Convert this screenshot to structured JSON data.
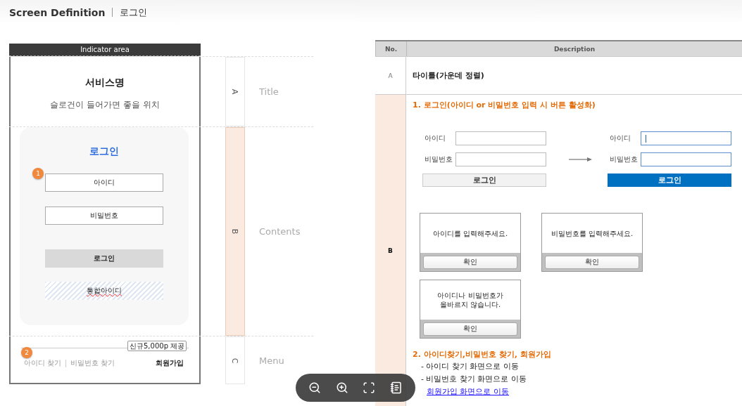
{
  "header": {
    "title": "Screen Definition",
    "subtitle": "로그인"
  },
  "phone": {
    "indicator": "Indicator area",
    "service_name": "서비스명",
    "slogan": "슬로건이 들어가면 좋을 위치",
    "card_title": "로그인",
    "fields": [
      {
        "text": "아이디",
        "marker": "1"
      },
      {
        "text": "비밀번호"
      }
    ],
    "login_button": "로그인",
    "integrated_button": "통합아이디",
    "menu": {
      "marker": "2",
      "tooltip": "신규5,000p 제공",
      "links": [
        "아이디 찾기",
        "비밀번호 찾기"
      ],
      "signup": "회원가입"
    }
  },
  "sections": [
    {
      "letter": "A",
      "label": "Title",
      "selected": false
    },
    {
      "letter": "B",
      "label": "Contents",
      "selected": true
    },
    {
      "letter": "C",
      "label": "Menu",
      "selected": false
    }
  ],
  "table": {
    "columns": [
      "No.",
      "Description"
    ],
    "rows": [
      {
        "no": "A",
        "selected": false,
        "kind": "text",
        "text": "타이틀(가운데 정렬)"
      },
      {
        "no": "B",
        "selected": true,
        "kind": "detail",
        "heading_1": "1. 로그인(아이디 or 비밀번호 입력 시 버튼 활성화)",
        "forms": [
          {
            "active": false,
            "fields": [
              {
                "label": "아이디",
                "caret": false
              },
              {
                "label": "비밀번호",
                "caret": false
              }
            ],
            "button": "로그인"
          },
          {
            "active": true,
            "fields": [
              {
                "label": "아이디",
                "caret": true
              },
              {
                "label": "비밀번호",
                "caret": false
              }
            ],
            "button": "로그인"
          }
        ],
        "dialogs": [
          {
            "lines": [
              "아이디를 입력해주세요."
            ],
            "button": "확인"
          },
          {
            "lines": [
              "비밀번호를 입력해주세요."
            ],
            "button": "확인"
          },
          {
            "lines": [
              "아이디나 비밀번호가",
              "올바르지 않습니다."
            ],
            "button": "확인"
          }
        ],
        "heading_2": "2. 아이디찾기,비밀번호 찾기, 회원가입",
        "items": [
          {
            "kind": "text",
            "text": "- 아이디 찾기 화면으로 이동"
          },
          {
            "kind": "text",
            "text": "- 비밀번호 찾기 화면으로 이동"
          },
          {
            "kind": "link",
            "text": "회원가입 화면으로 이동"
          }
        ]
      }
    ]
  },
  "viewer_toolbar": {
    "buttons": [
      {
        "kind": "zoom-out"
      },
      {
        "kind": "zoom-in"
      },
      {
        "kind": "fullscreen"
      },
      {
        "kind": "notes"
      }
    ]
  }
}
